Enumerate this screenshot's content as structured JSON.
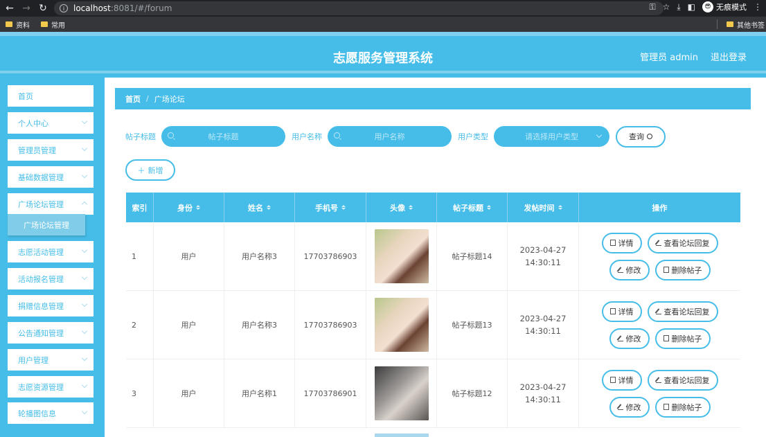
{
  "browser": {
    "url_host": "localhost",
    "url_rest": ":8081/#/forum",
    "profile_label": "无痕模式",
    "profile_avatar": "😎",
    "bookmarks": [
      "资料",
      "常用"
    ],
    "bookmarks_other": "其他书签"
  },
  "header": {
    "title": "志愿服务管理系统",
    "user": "管理员 admin",
    "logout": "退出登录"
  },
  "sidebar": {
    "items": [
      {
        "label": "首页"
      },
      {
        "label": "个人中心"
      },
      {
        "label": "管理员管理"
      },
      {
        "label": "基础数据管理"
      },
      {
        "label": "广场论坛管理"
      },
      {
        "label": "志愿活动管理"
      },
      {
        "label": "活动报名管理"
      },
      {
        "label": "捐赠信息管理"
      },
      {
        "label": "公告通知管理"
      },
      {
        "label": "用户管理"
      },
      {
        "label": "志愿资源管理"
      },
      {
        "label": "轮播图信息"
      }
    ],
    "active_sub": "广场论坛管理"
  },
  "breadcrumb": {
    "home": "首页",
    "sep": "/",
    "current": "广场论坛"
  },
  "search": {
    "title_label": "帖子标题",
    "title_placeholder": "帖子标题",
    "user_label": "用户名称",
    "user_placeholder": "用户名称",
    "type_label": "用户类型",
    "type_placeholder": "请选择用户类型",
    "query_button": "查询",
    "add_button": "新增"
  },
  "table": {
    "headers": [
      "索引",
      "身份",
      "姓名",
      "手机号",
      "头像",
      "帖子标题",
      "发帖时间",
      "操作"
    ],
    "rows": [
      {
        "index": "1",
        "role": "用户",
        "name": "用户名称3",
        "phone": "17703786903",
        "title": "帖子标题14",
        "time": "2023-04-27 14:30:11"
      },
      {
        "index": "2",
        "role": "用户",
        "name": "用户名称3",
        "phone": "17703786903",
        "title": "帖子标题13",
        "time": "2023-04-27 14:30:11"
      },
      {
        "index": "3",
        "role": "用户",
        "name": "用户名称1",
        "phone": "17703786901",
        "title": "帖子标题12",
        "time": "2023-04-27 14:30:11"
      }
    ],
    "actions": {
      "detail": "详情",
      "replies": "查看论坛回复",
      "edit": "修改",
      "delete": "删除帖子"
    }
  },
  "colors": {
    "primary": "#46bde8",
    "light": "#7fcde9"
  }
}
